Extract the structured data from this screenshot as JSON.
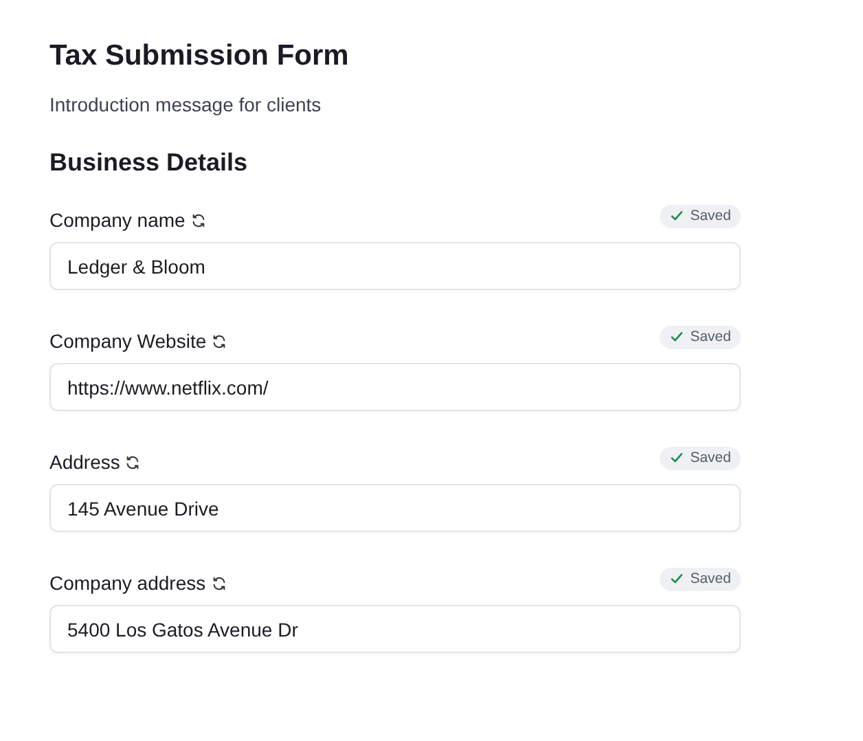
{
  "form": {
    "title": "Tax Submission Form",
    "intro": "Introduction message for clients"
  },
  "section": {
    "title": "Business Details"
  },
  "fields": [
    {
      "label": "Company name",
      "value": "Ledger & Bloom",
      "status": "Saved",
      "saved": true
    },
    {
      "label": "Company Website",
      "value": "https://www.netflix.com/",
      "status": "Saved",
      "saved": true
    },
    {
      "label": "Address",
      "value": "145 Avenue Drive",
      "status": "Saved",
      "saved": true
    },
    {
      "label": "Company address",
      "value": "5400 Los Gatos Avenue Dr",
      "status": "Saved",
      "saved": true
    }
  ]
}
